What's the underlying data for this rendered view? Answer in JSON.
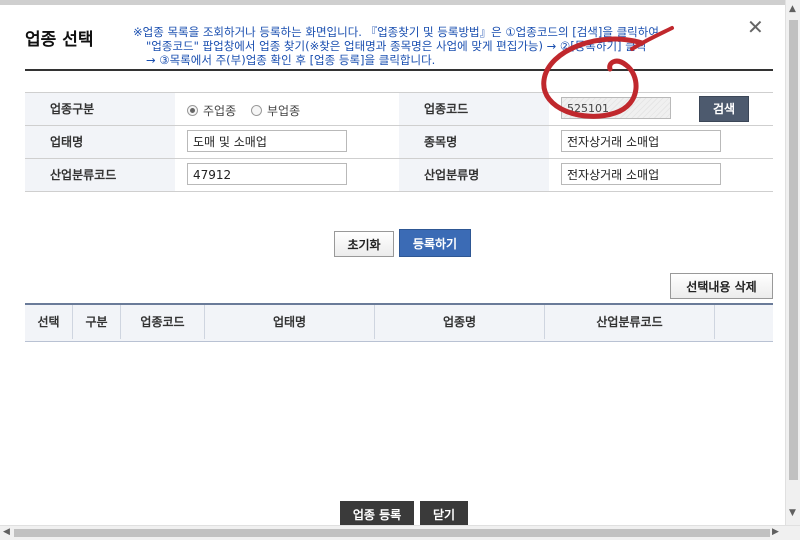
{
  "background_ghost": "",
  "dialog": {
    "title": "업종 선택",
    "notice": {
      "line1": "※업종 목록을 조회하거나 등록하는 화면입니다. 『업종찾기 및 등록방법』은 ①업종코드의 [검색]을 클릭하여",
      "line2": "\"업종코드\" 팝업창에서 업종 찾기(※찾은 업태명과 종목명은 사업에 맞게 편집가능) → ②[등록하기] 클릭",
      "line3": "→ ③목록에서 주(부)업종 확인 후 [업종 등록]을 클릭합니다."
    },
    "close_symbol": "✕"
  },
  "form": {
    "industry_type_label": "업종구분",
    "radio_main_label": "주업종",
    "radio_sub_label": "부업종",
    "radio_selected": "main",
    "industry_code_label": "업종코드",
    "industry_code_value": "525101",
    "search_button_label": "검색",
    "business_type_label": "업태명",
    "business_type_value": "도매 및 소매업",
    "item_name_label": "종목명",
    "item_name_value": "전자상거래 소매업",
    "industrial_code_label": "산업분류코드",
    "industrial_code_value": "47912",
    "industrial_name_label": "산업분류명",
    "industrial_name_value": "전자상거래 소매업"
  },
  "actions": {
    "reset_label": "초기화",
    "register_label": "등록하기",
    "delete_selected_label": "선택내용 삭제"
  },
  "grid": {
    "columns": [
      "선택",
      "구분",
      "업종코드",
      "업태명",
      "업종명",
      "산업분류코드",
      ""
    ]
  },
  "footer": {
    "add_industry_label": "업종 등록",
    "close_label": "닫기"
  },
  "colors": {
    "notice_text": "#1a4fb0",
    "primary_button": "#3b6bb5",
    "search_button": "#4d5a6e",
    "footer_button": "#3a3a3a",
    "annotation_scribble": "#c0282d"
  },
  "icons": {
    "close": "close-icon",
    "scroll_up": "arrow-up-icon",
    "scroll_down": "arrow-down-icon",
    "scroll_left": "arrow-left-icon",
    "scroll_right": "arrow-right-icon"
  }
}
